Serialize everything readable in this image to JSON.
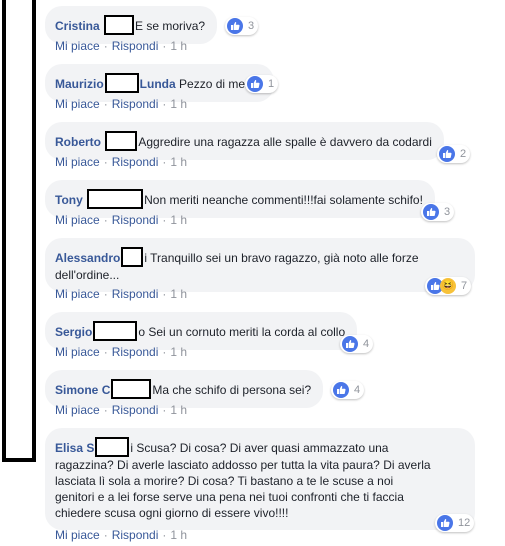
{
  "comments": [
    {
      "author": "Cristina",
      "text": "E se moriva?",
      "reactions": "3",
      "like": "Mi piace",
      "reply": "Rispondi",
      "time": "1 h"
    },
    {
      "author": "Maurizio",
      "author_tail": "Lunda",
      "text": "Pezzo di merda",
      "reactions": "1",
      "like": "Mi piace",
      "reply": "Rispondi",
      "time": "1 h"
    },
    {
      "author": "Roberto",
      "text": "Aggredire una ragazza alle spalle è davvero da codardi",
      "reactions": "2",
      "like": "Mi piace",
      "reply": "Rispondi",
      "time": "1 h"
    },
    {
      "author": "Tony",
      "text": "Non meriti neanche commenti!!!fai solamente schifo!",
      "reactions": "3",
      "like": "Mi piace",
      "reply": "Rispondi",
      "time": "1 h"
    },
    {
      "author": "Alessandro",
      "text_line1": "i Tranquillo sei un bravo ragazzo, già noto alle forze",
      "text_line2": "dell'ordine...",
      "reactions": "7",
      "like": "Mi piace",
      "reply": "Rispondi",
      "time": "1 h"
    },
    {
      "author": "Sergio",
      "author_tail": "o",
      "text": "Sei un cornuto meriti la corda al collo",
      "reactions": "4",
      "like": "Mi piace",
      "reply": "Rispondi",
      "time": "1 h"
    },
    {
      "author": "Simone",
      "author_tail": "C",
      "text": "Ma che schifo di persona sei?",
      "reactions": "4",
      "like": "Mi piace",
      "reply": "Rispondi",
      "time": "1 h"
    },
    {
      "author": "Elisa S",
      "text_line1": "i Scusa? Di cosa? Di aver quasi ammazzato una",
      "text_line2": "ragazzina? Di averle lasciato addosso per tutta la vita paura? Di averla",
      "text_line3": "lasciata lì sola a morire? Di cosa? Ti bastano a te le scuse a noi",
      "text_line4": "genitori e a lei forse serve una pena nei tuoi confronti che ti faccia",
      "text_line5": "chiedere scusa ogni giorno di essere vivo!!!!",
      "reactions": "12",
      "like": "Mi piace",
      "reply": "Rispondi",
      "time": "1 h"
    }
  ],
  "separator": "·",
  "colors": {
    "name": "#385898",
    "bubble": "#f2f3f5",
    "like": "#4a76e8",
    "meta": "#90949c"
  }
}
